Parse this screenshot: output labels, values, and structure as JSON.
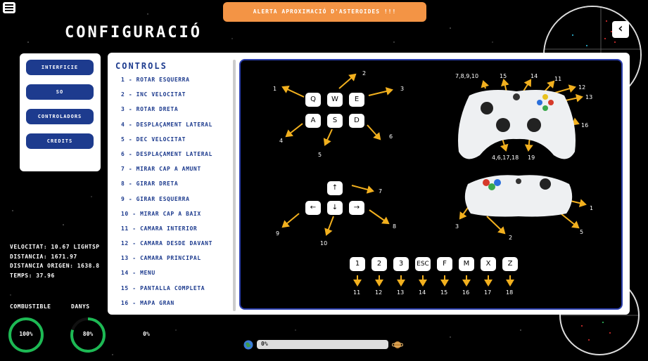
{
  "alert": {
    "text": "ALERTA APROXIMACIÓ D'ASTEROIDES !!!"
  },
  "page": {
    "title": "CONFIGURACIÓ"
  },
  "back": {
    "icon": "chevron-left-icon",
    "glyph": "‹"
  },
  "menu_icon": "hamburger-menu-icon",
  "side_menu": {
    "items": [
      {
        "label": "INTERFICIE"
      },
      {
        "label": "SO"
      },
      {
        "label": "CONTROLADORS"
      },
      {
        "label": "CREDITS"
      }
    ]
  },
  "stats": {
    "velocitat": "VELOCITAT: 10.67 LIGHTSP",
    "distancia": "DISTANCIA: 1671.97",
    "distancia_origen": "DISTANCIA ORIGEN: 1638.8",
    "temps": "TEMPS: 37.96"
  },
  "gauges": {
    "combustible_label": "COMBUSTIBLE",
    "danys_label": "DANYS",
    "combustible_value": "100%",
    "danys_value": "80%",
    "third_value": "0%",
    "combustible_fraction": 1.0,
    "danys_fraction": 0.8,
    "color": "#1db954"
  },
  "progress": {
    "text": "0%",
    "fraction": 0.0,
    "start_icon": "earth-icon",
    "end_icon": "planet-icon"
  },
  "controls": {
    "title": "CONTROLS",
    "items": [
      "1 - ROTAR ESQUERRA",
      "2 - INC VELOCITAT",
      "3 - ROTAR DRETA",
      "4 - DESPLAÇAMENT LATERAL",
      "5 - DEC VELOCITAT",
      "6 - DESPLAÇAMENT LATERAL",
      "7 - MIRAR CAP A AMUNT",
      "8 - GIRAR DRETA",
      "9 - GIRAR ESQUERRA",
      "10 - MIRAR CAP A BAIX",
      "11 - CAMARA INTERIOR",
      "12 - CAMARA DESDE DAVANT",
      "13 - CAMARA PRINCIPAL",
      "14 - MENU",
      "15 - PANTALLA COMPLETA",
      "16 - MAPA GRAN"
    ]
  },
  "diagram": {
    "keys_top": [
      "Q",
      "W",
      "E"
    ],
    "keys_bottom": [
      "A",
      "S",
      "D"
    ],
    "wasd_numbers": [
      "1",
      "2",
      "3",
      "4",
      "5",
      "6"
    ],
    "arrow_numbers": [
      "7",
      "8",
      "9",
      "10"
    ],
    "hotkeys": [
      "1",
      "2",
      "3",
      "ESC",
      "F",
      "M",
      "X",
      "Z"
    ],
    "hotkey_numbers": [
      "11",
      "12",
      "13",
      "14",
      "15",
      "16",
      "17",
      "18"
    ],
    "pad_labels_top": [
      "7,8,9,10",
      "15",
      "14",
      "11",
      "12",
      "13",
      "16",
      "4,6,17,18",
      "19"
    ],
    "pad_labels_bottom": [
      "1",
      "2",
      "3",
      "5"
    ],
    "arrow_color": "#f2b01e"
  }
}
